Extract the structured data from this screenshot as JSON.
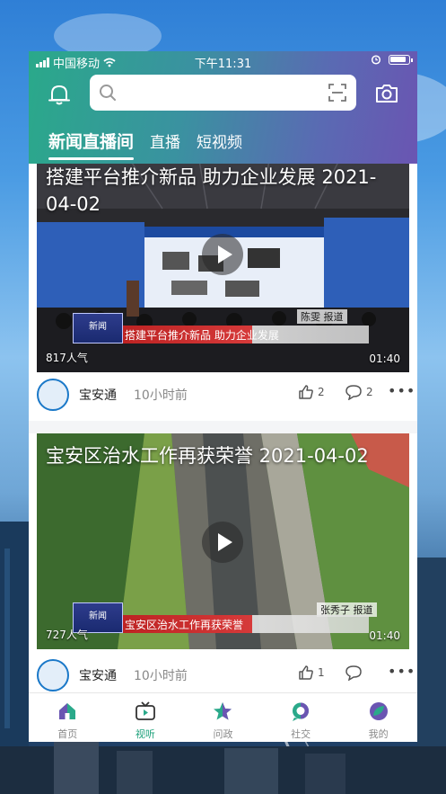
{
  "status_bar": {
    "carrier": "中国移动",
    "time": "下午11:31"
  },
  "header": {
    "search_placeholder": "",
    "tabs": [
      {
        "label": "新闻直播间",
        "active": true
      },
      {
        "label": "直播",
        "active": false
      },
      {
        "label": "短视频",
        "active": false
      }
    ],
    "colors": {
      "gradient_start": "#2aa98a",
      "gradient_end": "#6a55b2"
    }
  },
  "feed": [
    {
      "title": "搭建平台推介新品  助力企业发展 2021-04-02",
      "lower_third": "搭建平台推介新品  助力企业发展",
      "reporter": "陈雯  报道",
      "views": "817人气",
      "duration": "01:40",
      "source": "宝安通",
      "time_ago": "10小时前",
      "likes": "2",
      "comments": "2",
      "comment_label": ""
    },
    {
      "title": "宝安区治水工作再获荣誉 2021-04-02",
      "lower_third": "宝安区治水工作再获荣誉",
      "reporter": "张秀子  报道",
      "views": "727人气",
      "duration": "01:40",
      "source": "宝安通",
      "time_ago": "10小时前",
      "likes": "1",
      "comments": "",
      "comment_label": ""
    }
  ],
  "bottom_nav": [
    {
      "label": "首页",
      "icon": "home-icon",
      "active": false
    },
    {
      "label": "视听",
      "icon": "tv-icon",
      "active": true
    },
    {
      "label": "问政",
      "icon": "star-icon",
      "active": false
    },
    {
      "label": "社交",
      "icon": "chat-bubble-icon",
      "active": false
    },
    {
      "label": "我的",
      "icon": "profile-leaf-icon",
      "active": false
    }
  ]
}
